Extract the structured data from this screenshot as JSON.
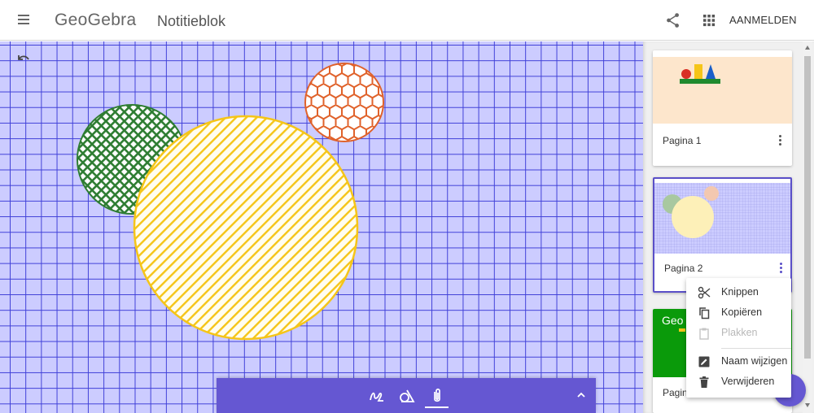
{
  "header": {
    "logo": "GeoGebra",
    "title": "Notitieblok",
    "signin_label": "AANMELDEN",
    "menu_icon": "hamburger-menu-icon",
    "share_icon": "share-icon",
    "apps_icon": "apps-grid-icon"
  },
  "canvas": {
    "background_color": "#ccccff",
    "grid_color": "#4040d8",
    "undo_icon": "undo-icon",
    "shapes": [
      {
        "name": "green-crosshatch-circle",
        "color": "#2e7d32",
        "pattern": "crosshatch"
      },
      {
        "name": "orange-hexagon-circle",
        "color": "#e0622b",
        "pattern": "hexagon"
      },
      {
        "name": "yellow-hatched-circle",
        "color": "#f5c518",
        "pattern": "diagonal-lines"
      }
    ]
  },
  "toolbar": {
    "background_color": "#6557d2",
    "tools": [
      {
        "name": "pen-tool-icon"
      },
      {
        "name": "shapes-tool-icon"
      },
      {
        "name": "attachment-tool-icon",
        "selected": true
      }
    ],
    "collapse_icon": "chevron-up-icon"
  },
  "pages": [
    {
      "label": "Pagina 1",
      "thumb_color": "#fde6cc"
    },
    {
      "label": "Pagina 2",
      "thumb_color": "#ccccff",
      "selected": true
    },
    {
      "label": "Pagin",
      "thumb_color": "#0a9a0a",
      "thumb_text": "Geo"
    }
  ],
  "context_menu": {
    "items": [
      {
        "label": "Knippen",
        "icon": "scissors-icon",
        "enabled": true
      },
      {
        "label": "Kopiëren",
        "icon": "copy-icon",
        "enabled": true
      },
      {
        "label": "Plakken",
        "icon": "paste-icon",
        "enabled": false
      },
      {
        "label": "Naam wijzigen",
        "icon": "rename-icon",
        "enabled": true
      },
      {
        "label": "Verwijderen",
        "icon": "trash-icon",
        "enabled": true
      }
    ]
  },
  "colors": {
    "accent": "#6557d2",
    "selected_border": "#5a4fc8"
  }
}
